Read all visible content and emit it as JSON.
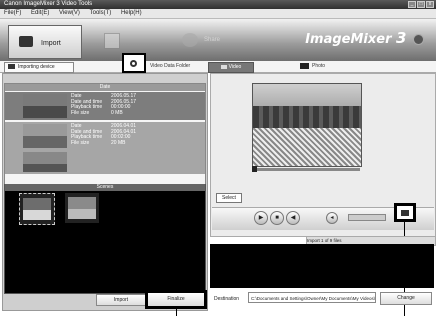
{
  "window": {
    "title": "Canon ImageMixer 3 Video Tools"
  },
  "menu": {
    "items": [
      "File(F)",
      "Edit(E)",
      "View(V)",
      "Tools(T)",
      "Help(H)"
    ]
  },
  "modes": {
    "import": "Import",
    "edit": "",
    "share": "Share"
  },
  "brand": {
    "name": "ImageMixer",
    "version": "3"
  },
  "toolbar": {
    "device": "Importing device",
    "link": "Video Data Folder",
    "tab_video": "Video",
    "tab_photo": "Photo"
  },
  "dates": {
    "header": "Date",
    "rows": [
      {
        "fields": [
          [
            "Date",
            "2006.05.17"
          ],
          [
            "Date and time",
            "2006.05.17"
          ],
          [
            "Playback time",
            "00:00:00"
          ],
          [
            "File size",
            "0 MB"
          ]
        ]
      },
      {
        "fields": [
          [
            "Date",
            "2006.04.01"
          ],
          [
            "Date and time",
            "2006.04.01"
          ],
          [
            "Playback time",
            "00:02:00"
          ],
          [
            "File size",
            "20 MB"
          ]
        ]
      }
    ]
  },
  "scenes": {
    "header": "Scenes"
  },
  "buttons": {
    "import": "Import",
    "finalize": "Finalize",
    "change": "Change"
  },
  "preview": {
    "chip": "Select"
  },
  "tray": {
    "tabs": "Import 1 of 9 files"
  },
  "destination": {
    "label": "Destination",
    "path": "C:\\Documents and Settings\\Owner\\My Documents\\My Videos\\Video Data"
  }
}
